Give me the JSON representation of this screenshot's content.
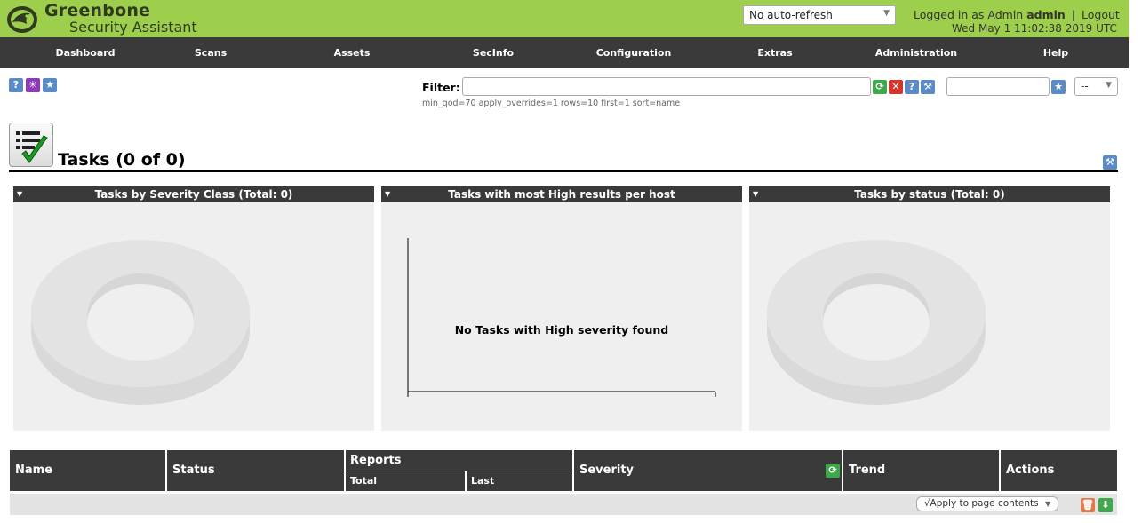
{
  "header": {
    "brand_line1": "Greenbone",
    "brand_line2": "Security Assistant",
    "auto_refresh": "No auto-refresh",
    "logged_in_prefix": "Logged in as",
    "role": "Admin",
    "username": "admin",
    "separator": "|",
    "logout": "Logout",
    "datetime": "Wed May 1 11:02:38 2019 UTC"
  },
  "nav": {
    "items": [
      "Dashboard",
      "Scans",
      "Assets",
      "SecInfo",
      "Configuration",
      "Extras",
      "Administration",
      "Help"
    ]
  },
  "toolbar": {
    "filter_label": "Filter",
    "filter_value": "",
    "filter_text": "min_qod=70 apply_overrides=1 rows=10 first=1 sort=name",
    "filter_select": "--"
  },
  "page": {
    "title": "Tasks (0 of 0)"
  },
  "panels": [
    {
      "title": "Tasks by Severity Class (Total: 0)"
    },
    {
      "title": "Tasks with most High results per host",
      "empty_message": "No Tasks with High severity found"
    },
    {
      "title": "Tasks by status (Total: 0)"
    }
  ],
  "table": {
    "columns": {
      "name": "Name",
      "status": "Status",
      "reports": "Reports",
      "total": "Total",
      "last": "Last",
      "severity": "Severity",
      "trend": "Trend",
      "actions": "Actions"
    },
    "rows": []
  },
  "footer": {
    "apply_label": "√Apply to page contents"
  },
  "colors": {
    "header_green": "#9ecf4c",
    "nav_dark": "#3a3a3a",
    "panel_bg": "#efefef",
    "donut": "#e0e0e0"
  }
}
